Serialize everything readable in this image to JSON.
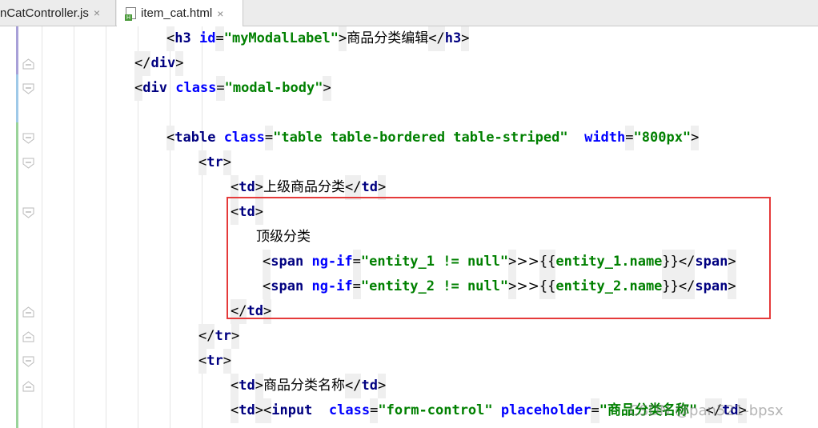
{
  "tabs": [
    {
      "label": "nCatController.js",
      "close": "×",
      "active": false
    },
    {
      "label": "item_cat.html",
      "close": "×",
      "active": true
    }
  ],
  "lines": [
    {
      "indent": 208,
      "tokens": [
        [
          "punc",
          "<"
        ],
        [
          "tag",
          "h3"
        ],
        [
          "sp",
          " "
        ],
        [
          "attr",
          "id"
        ],
        [
          "punc",
          "="
        ],
        [
          "val",
          "\"myModalLabel\""
        ],
        [
          "punc",
          ">"
        ],
        [
          "txt",
          "商品分类编辑"
        ],
        [
          "punc",
          "</"
        ],
        [
          "tag",
          "h3"
        ],
        [
          "punc",
          ">"
        ]
      ]
    },
    {
      "indent": 168,
      "tokens": [
        [
          "punc",
          "</"
        ],
        [
          "tag",
          "div"
        ],
        [
          "punc",
          ">"
        ]
      ]
    },
    {
      "indent": 168,
      "tokens": [
        [
          "punc",
          "<"
        ],
        [
          "tag",
          "div"
        ],
        [
          "sp",
          " "
        ],
        [
          "attr",
          "class"
        ],
        [
          "punc",
          "="
        ],
        [
          "val",
          "\"modal-body\""
        ],
        [
          "punc",
          ">"
        ]
      ]
    },
    {
      "indent": 168,
      "tokens": []
    },
    {
      "indent": 208,
      "tokens": [
        [
          "punc",
          "<"
        ],
        [
          "tag",
          "table"
        ],
        [
          "sp",
          " "
        ],
        [
          "attr",
          "class"
        ],
        [
          "punc",
          "="
        ],
        [
          "val",
          "\"table table-bordered table-striped\""
        ],
        [
          "sp",
          "  "
        ],
        [
          "attr",
          "width"
        ],
        [
          "punc",
          "="
        ],
        [
          "val",
          "\"800px\""
        ],
        [
          "punc",
          ">"
        ]
      ]
    },
    {
      "indent": 248,
      "tokens": [
        [
          "punc",
          "<"
        ],
        [
          "tag",
          "tr"
        ],
        [
          "punc",
          ">"
        ]
      ]
    },
    {
      "indent": 288,
      "tokens": [
        [
          "punc",
          "<"
        ],
        [
          "tag",
          "td"
        ],
        [
          "punc",
          ">"
        ],
        [
          "txt",
          "上级商品分类"
        ],
        [
          "punc",
          "</"
        ],
        [
          "tag",
          "td"
        ],
        [
          "punc",
          ">"
        ]
      ]
    },
    {
      "indent": 288,
      "tokens": [
        [
          "punc",
          "<"
        ],
        [
          "tag",
          "td"
        ],
        [
          "punc",
          ">"
        ]
      ]
    },
    {
      "indent": 320,
      "tokens": [
        [
          "txt",
          "顶级分类"
        ]
      ]
    },
    {
      "indent": 328,
      "tokens": [
        [
          "punc",
          "<"
        ],
        [
          "tag",
          "span"
        ],
        [
          "sp",
          " "
        ],
        [
          "attr",
          "ng-if"
        ],
        [
          "punc",
          "="
        ],
        [
          "val",
          "\"entity_1 != null\""
        ],
        [
          "punc",
          ">"
        ],
        [
          "txt",
          ">>"
        ],
        [
          "punc",
          "{{"
        ],
        [
          "val",
          "entity_1.name"
        ],
        [
          "punc",
          "}}"
        ],
        [
          "punc",
          "</"
        ],
        [
          "tag",
          "span"
        ],
        [
          "punc",
          ">"
        ]
      ]
    },
    {
      "indent": 328,
      "tokens": [
        [
          "punc",
          "<"
        ],
        [
          "tag",
          "span"
        ],
        [
          "sp",
          " "
        ],
        [
          "attr",
          "ng-if"
        ],
        [
          "punc",
          "="
        ],
        [
          "val",
          "\"entity_2 != null\""
        ],
        [
          "punc",
          ">"
        ],
        [
          "txt",
          ">>"
        ],
        [
          "punc",
          "{{"
        ],
        [
          "val",
          "entity_2.name"
        ],
        [
          "punc",
          "}}"
        ],
        [
          "punc",
          "</"
        ],
        [
          "tag",
          "span"
        ],
        [
          "punc",
          ">"
        ]
      ]
    },
    {
      "indent": 288,
      "tokens": [
        [
          "punc",
          "</"
        ],
        [
          "tag",
          "td"
        ],
        [
          "punc",
          ">"
        ]
      ]
    },
    {
      "indent": 248,
      "tokens": [
        [
          "punc",
          "</"
        ],
        [
          "tag",
          "tr"
        ],
        [
          "punc",
          ">"
        ]
      ]
    },
    {
      "indent": 248,
      "tokens": [
        [
          "punc",
          "<"
        ],
        [
          "tag",
          "tr"
        ],
        [
          "punc",
          ">"
        ]
      ]
    },
    {
      "indent": 288,
      "tokens": [
        [
          "punc",
          "<"
        ],
        [
          "tag",
          "td"
        ],
        [
          "punc",
          ">"
        ],
        [
          "txt",
          "商品分类名称"
        ],
        [
          "punc",
          "</"
        ],
        [
          "tag",
          "td"
        ],
        [
          "punc",
          ">"
        ]
      ]
    },
    {
      "indent": 288,
      "tokens": [
        [
          "punc",
          "<"
        ],
        [
          "tag",
          "td"
        ],
        [
          "punc",
          ">"
        ],
        [
          "punc",
          "<"
        ],
        [
          "tag",
          "input"
        ],
        [
          "sp",
          "  "
        ],
        [
          "attr",
          "class"
        ],
        [
          "punc",
          "="
        ],
        [
          "val",
          "\"form-control\""
        ],
        [
          "sp",
          " "
        ],
        [
          "attr",
          "placeholder"
        ],
        [
          "punc",
          "="
        ],
        [
          "val",
          "\"商品分类名称\""
        ],
        [
          "sp",
          " "
        ],
        [
          "punc",
          "</"
        ],
        [
          "tag",
          "td"
        ],
        [
          "punc",
          ">"
        ]
      ]
    }
  ],
  "watermark": "CSDN @pan521-bpsx",
  "colors": {
    "tag": "#000080",
    "attr": "#0000ff",
    "value": "#008000",
    "highlight": "#e53a3a"
  }
}
